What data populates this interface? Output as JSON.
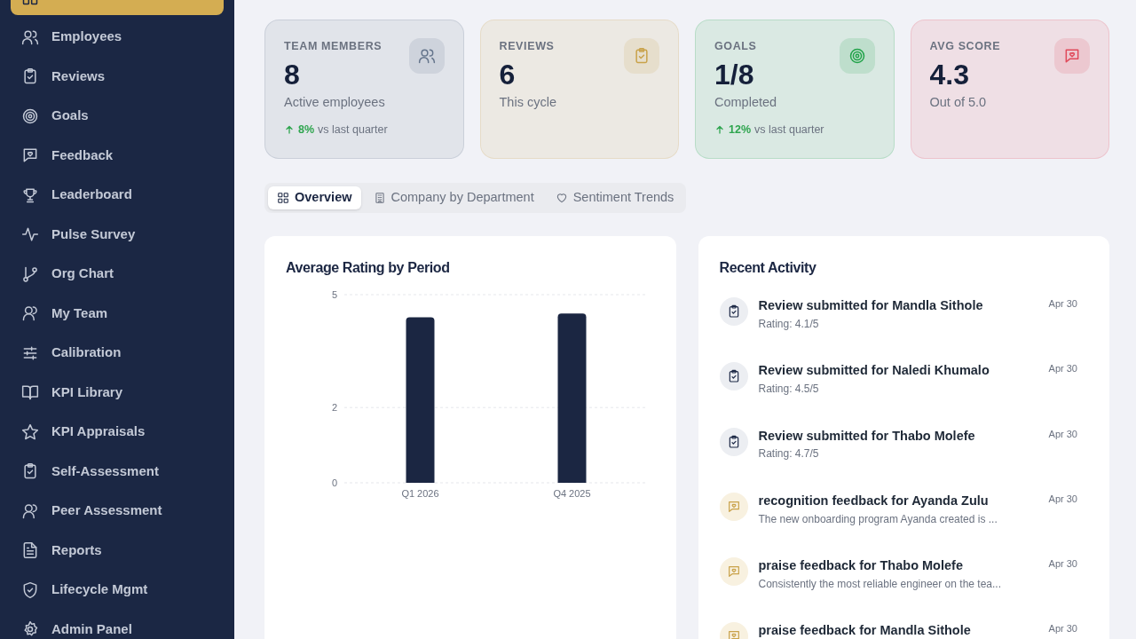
{
  "sidebar": {
    "items": [
      {
        "selected": true
      },
      {
        "label": "Employees",
        "selected": false
      },
      {
        "label": "Reviews",
        "selected": false
      },
      {
        "label": "Goals",
        "selected": false
      },
      {
        "label": "Feedback",
        "selected": false
      },
      {
        "label": "Leaderboard",
        "selected": false
      },
      {
        "label": "Pulse Survey",
        "selected": false
      },
      {
        "label": "Org Chart",
        "selected": false
      },
      {
        "label": "My Team",
        "selected": false
      },
      {
        "label": "Calibration",
        "selected": false
      },
      {
        "label": "KPI Library",
        "selected": false
      },
      {
        "label": "KPI Appraisals",
        "selected": false
      },
      {
        "label": "Self-Assessment",
        "selected": false
      },
      {
        "label": "Peer Assessment",
        "selected": false
      },
      {
        "label": "Reports",
        "selected": false
      },
      {
        "label": "Lifecycle Mgmt",
        "selected": false
      },
      {
        "label": "Admin Panel",
        "selected": false
      }
    ]
  },
  "stats": [
    {
      "label": "TEAM MEMBERS",
      "value": "8",
      "caption": "Active employees",
      "color": "#64748b",
      "trend": {
        "value": "8%",
        "text": "vs last quarter"
      }
    },
    {
      "label": "REVIEWS",
      "value": "6",
      "caption": "This cycle",
      "color": "#c9a24a"
    },
    {
      "label": "GOALS",
      "value": "1/8",
      "caption": "Completed",
      "color": "#22a34a",
      "trend": {
        "value": "12%",
        "text": "vs last quarter"
      }
    },
    {
      "label": "AVG SCORE",
      "value": "4.3",
      "caption": "Out of 5.0",
      "color": "#e0495a"
    }
  ],
  "tabs": [
    {
      "label": "Overview",
      "selected": true
    },
    {
      "label": "Company by Department",
      "selected": false
    },
    {
      "label": "Sentiment Trends",
      "selected": false
    }
  ],
  "rating_chart": {
    "title": "Average Rating by Period",
    "chart_data": {
      "type": "bar",
      "categories": [
        "Q1 2026",
        "Q4 2025"
      ],
      "values": [
        4.4,
        4.5
      ],
      "ylim": [
        0,
        5
      ],
      "yticks": [
        0,
        2,
        5
      ]
    }
  },
  "recent_activity": {
    "title": "Recent Activity",
    "items": [
      {
        "kind": "review",
        "title": "Review submitted for Mandla Sithole",
        "detail": "Rating: 4.1/5",
        "date": "Apr 30"
      },
      {
        "kind": "review",
        "title": "Review submitted for Naledi Khumalo",
        "detail": "Rating: 4.5/5",
        "date": "Apr 30"
      },
      {
        "kind": "review",
        "title": "Review submitted for Thabo Molefe",
        "detail": "Rating: 4.7/5",
        "date": "Apr 30"
      },
      {
        "kind": "feedback",
        "title": "recognition feedback for Ayanda Zulu",
        "detail": "The new onboarding program Ayanda created is ...",
        "date": "Apr 30"
      },
      {
        "kind": "feedback",
        "title": "praise feedback for Thabo Molefe",
        "detail": "Consistently the most reliable engineer on the tea...",
        "date": "Apr 30"
      },
      {
        "kind": "feedback",
        "title": "praise feedback for Mandla Sithole",
        "date": "Apr 30"
      }
    ]
  }
}
